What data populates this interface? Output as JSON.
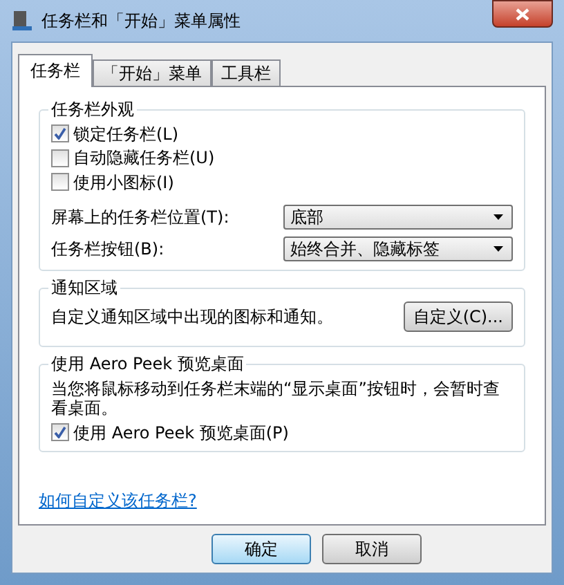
{
  "window": {
    "title": "任务栏和「开始」菜单属性"
  },
  "tabs": [
    {
      "label": "任务栏",
      "selected": true
    },
    {
      "label": "「开始」菜单",
      "selected": false
    },
    {
      "label": "工具栏",
      "selected": false
    }
  ],
  "appearance": {
    "title": "任务栏外观",
    "checkboxes": [
      {
        "label": "锁定任务栏(L)",
        "checked": true
      },
      {
        "label": "自动隐藏任务栏(U)",
        "checked": false
      },
      {
        "label": "使用小图标(I)",
        "checked": false
      }
    ],
    "dropdowns": [
      {
        "label": "屏幕上的任务栏位置(T):",
        "value": "底部"
      },
      {
        "label": "任务栏按钮(B):",
        "value": "始终合并、隐藏标签"
      }
    ]
  },
  "notification_area": {
    "title": "通知区域",
    "text": "自定义通知区域中出现的图标和通知。",
    "button": "自定义(C)..."
  },
  "aero_peek": {
    "title": "使用 Aero Peek 预览桌面",
    "text": "当您将鼠标移动到任务栏末端的“显示桌面”按钮时，会暂时查看桌面。",
    "checkbox": {
      "label": "使用 Aero Peek 预览桌面(P)",
      "checked": true
    }
  },
  "help_link": "如何自定义该任务栏?",
  "buttons": [
    {
      "label": "确定",
      "selected": true
    },
    {
      "label": "取消",
      "selected": false
    }
  ]
}
